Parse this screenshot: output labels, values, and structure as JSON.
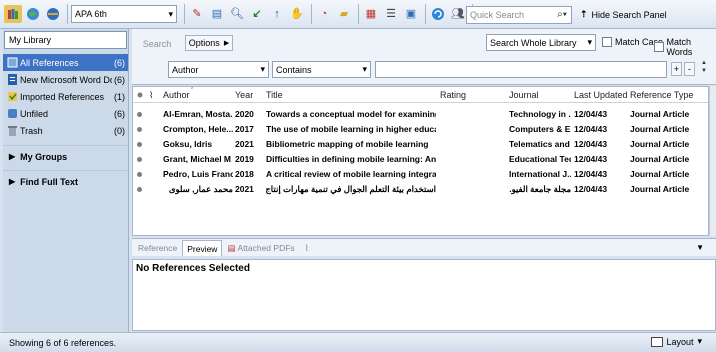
{
  "toolbar": {
    "icons": [
      "local-library-icon",
      "online-search-icon",
      "integrated-library-icon"
    ],
    "style_select": "APA 6th",
    "quick_search_placeholder": "Quick Search",
    "hide_search_label": "Hide Search Panel"
  },
  "left": {
    "library_title": "My Library",
    "items": [
      {
        "label": "All References",
        "count": "(6)"
      },
      {
        "label": "New Microsoft Word Doc...",
        "count": "(6)"
      },
      {
        "label": "Imported References",
        "count": "(1)"
      },
      {
        "label": "Unfiled",
        "count": "(6)"
      },
      {
        "label": "Trash",
        "count": "(0)"
      }
    ],
    "my_groups": "My Groups",
    "find_full_text": "Find Full Text"
  },
  "search": {
    "search_button": "Search",
    "options_button": "Options",
    "scope": "Search Whole Library",
    "match_case": "Match Case",
    "match_words": "Match Words",
    "field": "Author",
    "operator": "Contains",
    "value": ""
  },
  "table": {
    "headers": [
      "Author",
      "Year",
      "Title",
      "Rating",
      "Journal",
      "Last Updated",
      "Reference Type"
    ],
    "rows": [
      {
        "author": "Al-Emran, Mosta...",
        "year": "2020",
        "title": "Towards a conceptual model for examining th...",
        "journal": "Technology in ...",
        "updated": "12/04/43",
        "type": "Journal Article"
      },
      {
        "author": "Crompton, Hele...",
        "year": "2017",
        "title": "The use of mobile learning in higher education...",
        "journal": "Computers & E...",
        "updated": "12/04/43",
        "type": "Journal Article"
      },
      {
        "author": "Goksu, Idris",
        "year": "2021",
        "title": "Bibliometric mapping of mobile learning",
        "journal": "Telematics and ...",
        "updated": "12/04/43",
        "type": "Journal Article"
      },
      {
        "author": "Grant, Michael M",
        "year": "2019",
        "title": "Difficulties in defining mobile learning: Analysi...",
        "journal": "Educational Tec...",
        "updated": "12/04/43",
        "type": "Journal Article"
      },
      {
        "author": "Pedro, Luis Franc...",
        "year": "2018",
        "title": "A critical review of mobile learning integration...",
        "journal": "International J...",
        "updated": "12/04/43",
        "type": "Journal Article"
      },
      {
        "author": "محمد عمار, سلوى",
        "year": "2021",
        "title": "استخدام بيئة التعلم الجوال في تنمية مهارات إنتاج الدر...",
        "journal": "مجلة جامعة الفيو...",
        "updated": "12/04/43",
        "type": "Journal Article"
      }
    ]
  },
  "preview": {
    "tabs": [
      "Reference",
      "Preview",
      "Attached PDFs"
    ],
    "message": "No References Selected"
  },
  "status": {
    "text": "Showing 6 of 6 references.",
    "layout_label": "Layout"
  }
}
